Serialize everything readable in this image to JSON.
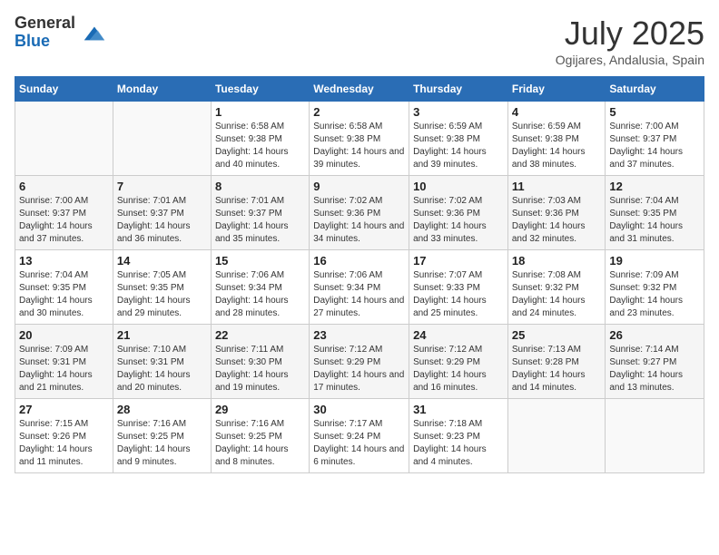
{
  "logo": {
    "general": "General",
    "blue": "Blue"
  },
  "title": "July 2025",
  "location": "Ogijares, Andalusia, Spain",
  "headers": [
    "Sunday",
    "Monday",
    "Tuesday",
    "Wednesday",
    "Thursday",
    "Friday",
    "Saturday"
  ],
  "weeks": [
    [
      {
        "day": "",
        "content": ""
      },
      {
        "day": "",
        "content": ""
      },
      {
        "day": "1",
        "content": "Sunrise: 6:58 AM\nSunset: 9:38 PM\nDaylight: 14 hours and 40 minutes."
      },
      {
        "day": "2",
        "content": "Sunrise: 6:58 AM\nSunset: 9:38 PM\nDaylight: 14 hours and 39 minutes."
      },
      {
        "day": "3",
        "content": "Sunrise: 6:59 AM\nSunset: 9:38 PM\nDaylight: 14 hours and 39 minutes."
      },
      {
        "day": "4",
        "content": "Sunrise: 6:59 AM\nSunset: 9:38 PM\nDaylight: 14 hours and 38 minutes."
      },
      {
        "day": "5",
        "content": "Sunrise: 7:00 AM\nSunset: 9:37 PM\nDaylight: 14 hours and 37 minutes."
      }
    ],
    [
      {
        "day": "6",
        "content": "Sunrise: 7:00 AM\nSunset: 9:37 PM\nDaylight: 14 hours and 37 minutes."
      },
      {
        "day": "7",
        "content": "Sunrise: 7:01 AM\nSunset: 9:37 PM\nDaylight: 14 hours and 36 minutes."
      },
      {
        "day": "8",
        "content": "Sunrise: 7:01 AM\nSunset: 9:37 PM\nDaylight: 14 hours and 35 minutes."
      },
      {
        "day": "9",
        "content": "Sunrise: 7:02 AM\nSunset: 9:36 PM\nDaylight: 14 hours and 34 minutes."
      },
      {
        "day": "10",
        "content": "Sunrise: 7:02 AM\nSunset: 9:36 PM\nDaylight: 14 hours and 33 minutes."
      },
      {
        "day": "11",
        "content": "Sunrise: 7:03 AM\nSunset: 9:36 PM\nDaylight: 14 hours and 32 minutes."
      },
      {
        "day": "12",
        "content": "Sunrise: 7:04 AM\nSunset: 9:35 PM\nDaylight: 14 hours and 31 minutes."
      }
    ],
    [
      {
        "day": "13",
        "content": "Sunrise: 7:04 AM\nSunset: 9:35 PM\nDaylight: 14 hours and 30 minutes."
      },
      {
        "day": "14",
        "content": "Sunrise: 7:05 AM\nSunset: 9:35 PM\nDaylight: 14 hours and 29 minutes."
      },
      {
        "day": "15",
        "content": "Sunrise: 7:06 AM\nSunset: 9:34 PM\nDaylight: 14 hours and 28 minutes."
      },
      {
        "day": "16",
        "content": "Sunrise: 7:06 AM\nSunset: 9:34 PM\nDaylight: 14 hours and 27 minutes."
      },
      {
        "day": "17",
        "content": "Sunrise: 7:07 AM\nSunset: 9:33 PM\nDaylight: 14 hours and 25 minutes."
      },
      {
        "day": "18",
        "content": "Sunrise: 7:08 AM\nSunset: 9:32 PM\nDaylight: 14 hours and 24 minutes."
      },
      {
        "day": "19",
        "content": "Sunrise: 7:09 AM\nSunset: 9:32 PM\nDaylight: 14 hours and 23 minutes."
      }
    ],
    [
      {
        "day": "20",
        "content": "Sunrise: 7:09 AM\nSunset: 9:31 PM\nDaylight: 14 hours and 21 minutes."
      },
      {
        "day": "21",
        "content": "Sunrise: 7:10 AM\nSunset: 9:31 PM\nDaylight: 14 hours and 20 minutes."
      },
      {
        "day": "22",
        "content": "Sunrise: 7:11 AM\nSunset: 9:30 PM\nDaylight: 14 hours and 19 minutes."
      },
      {
        "day": "23",
        "content": "Sunrise: 7:12 AM\nSunset: 9:29 PM\nDaylight: 14 hours and 17 minutes."
      },
      {
        "day": "24",
        "content": "Sunrise: 7:12 AM\nSunset: 9:29 PM\nDaylight: 14 hours and 16 minutes."
      },
      {
        "day": "25",
        "content": "Sunrise: 7:13 AM\nSunset: 9:28 PM\nDaylight: 14 hours and 14 minutes."
      },
      {
        "day": "26",
        "content": "Sunrise: 7:14 AM\nSunset: 9:27 PM\nDaylight: 14 hours and 13 minutes."
      }
    ],
    [
      {
        "day": "27",
        "content": "Sunrise: 7:15 AM\nSunset: 9:26 PM\nDaylight: 14 hours and 11 minutes."
      },
      {
        "day": "28",
        "content": "Sunrise: 7:16 AM\nSunset: 9:25 PM\nDaylight: 14 hours and 9 minutes."
      },
      {
        "day": "29",
        "content": "Sunrise: 7:16 AM\nSunset: 9:25 PM\nDaylight: 14 hours and 8 minutes."
      },
      {
        "day": "30",
        "content": "Sunrise: 7:17 AM\nSunset: 9:24 PM\nDaylight: 14 hours and 6 minutes."
      },
      {
        "day": "31",
        "content": "Sunrise: 7:18 AM\nSunset: 9:23 PM\nDaylight: 14 hours and 4 minutes."
      },
      {
        "day": "",
        "content": ""
      },
      {
        "day": "",
        "content": ""
      }
    ]
  ]
}
